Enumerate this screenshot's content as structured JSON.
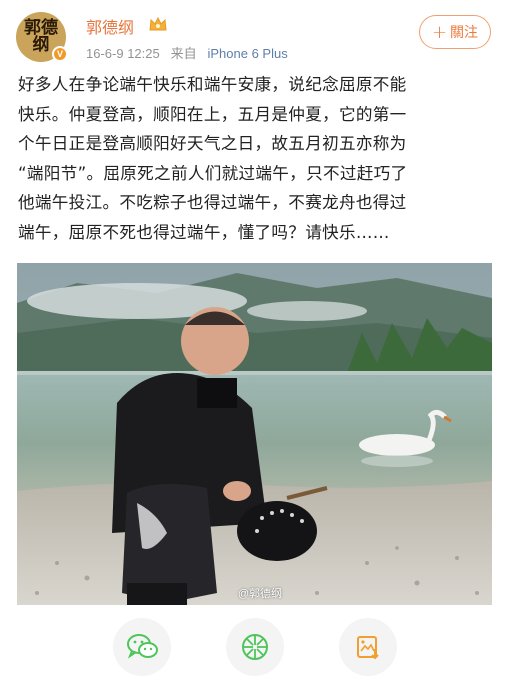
{
  "header": {
    "username": "郭德纲",
    "avatar_art": "郭德纲",
    "verified_mark": "V",
    "timestamp": "16-6-9 12:25",
    "source_prefix": "来自",
    "source_device": "iPhone 6 Plus",
    "follow_label": "關注",
    "follow_plus": "+"
  },
  "post": {
    "lines": [
      "好多人在争论端午快乐和端午安康，说纪念屈原不能",
      "快乐。仲夏登高，顺阳在上，五月是仲夏，它的第一",
      "个午日正是登高顺阳好天气之日，故五月初五亦称为",
      "“端阳节”。屈原死之前人们就过端午，只不过赶巧了",
      "他端午投江。不吃粽子也得过端午，不赛龙舟也得过",
      "端午，屈原不死也得过端午，懂了吗？请快乐……"
    ]
  },
  "photo": {
    "watermark": "@郭德纲"
  },
  "share": {
    "icons": [
      "wechat-icon",
      "moments-icon",
      "save-image-icon"
    ]
  },
  "colors": {
    "username": "#e8743b",
    "follow_border": "#f0a070",
    "meta_text": "#939393",
    "share_bg": "#f4f4f4",
    "wechat_green": "#4ec55a",
    "save_orange": "#f0a030"
  }
}
